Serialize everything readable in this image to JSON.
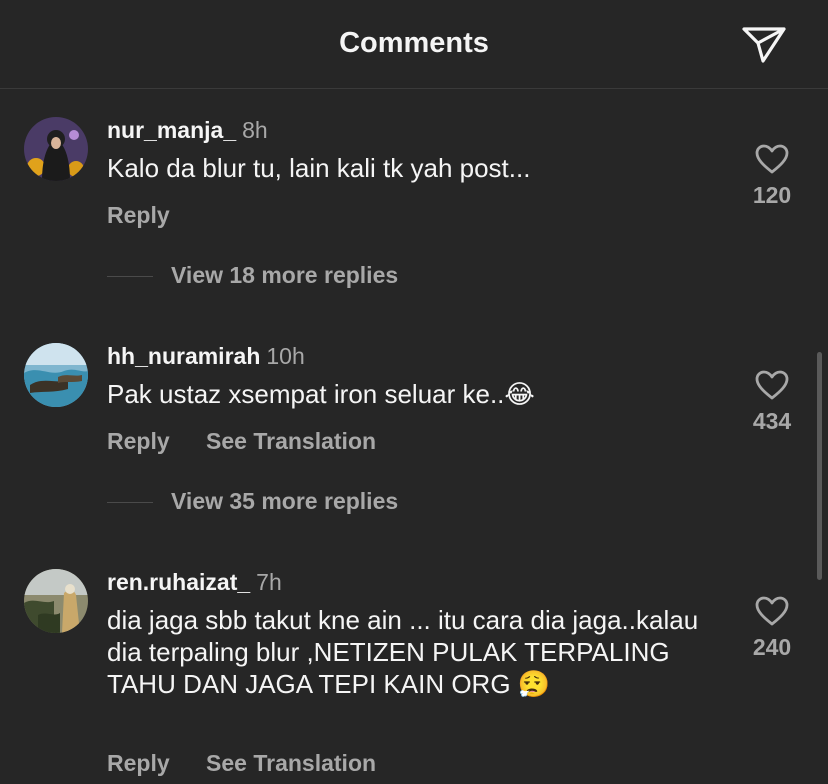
{
  "header": {
    "title": "Comments"
  },
  "comments": [
    {
      "username": "nur_manja_",
      "time": "8h",
      "text": "Kalo da blur tu, lain kali tk yah post...",
      "reply_label": "Reply",
      "likes": "120",
      "view_replies": "View 18 more replies"
    },
    {
      "username": "hh_nuramirah",
      "time": "10h",
      "text": "Pak ustaz xsempat iron seluar ke..😂",
      "reply_label": "Reply",
      "translate_label": "See Translation",
      "likes": "434",
      "view_replies": "View 35 more replies"
    },
    {
      "username": "ren.ruhaizat_",
      "time": "7h",
      "text": "dia jaga sbb takut kne ain ... itu cara dia jaga..kalau dia terpaling blur ,NETIZEN PULAK TERPALING TAHU DAN JAGA TEPI KAIN ORG 😮‍💨",
      "reply_label": "Reply",
      "translate_label": "See Translation",
      "likes": "240"
    }
  ],
  "icons": {
    "share": "paper-plane-icon",
    "like": "heart-outline-icon"
  },
  "colors": {
    "background": "#262626",
    "primary_text": "#f5f5f5",
    "secondary_text": "#a8a8a8"
  }
}
